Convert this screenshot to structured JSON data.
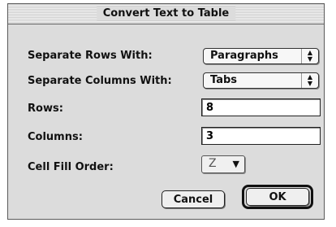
{
  "dialog": {
    "title": "Convert Text to Table"
  },
  "rows": {
    "separate_rows": {
      "label": "Separate Rows With:",
      "value": "Paragraphs"
    },
    "separate_columns": {
      "label": "Separate Columns With:",
      "value": "Tabs"
    },
    "rows_count": {
      "label": "Rows:",
      "value": "8"
    },
    "columns_count": {
      "label": "Columns:",
      "value": "3"
    },
    "cell_fill_order": {
      "label": "Cell Fill Order:",
      "value": "Z"
    }
  },
  "buttons": {
    "cancel": "Cancel",
    "ok": "OK"
  }
}
